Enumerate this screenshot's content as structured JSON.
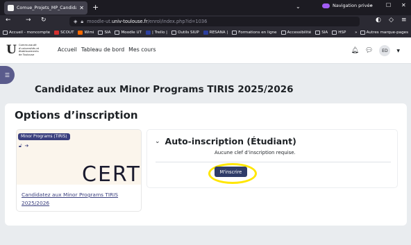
{
  "browser": {
    "tab_title": "Comue_Projets_MP_Candidature",
    "private_label": "Navigation privée",
    "url_prefix": "moodle-ut.",
    "url_domain": "univ-toulouse.fr",
    "url_path": "/enrol/index.php?id=1036"
  },
  "bookmarks": [
    {
      "label": "Accueil - moncompte",
      "icon": "globe-icon"
    },
    {
      "label": "SCOUT",
      "icon": "scout-icon"
    },
    {
      "label": "Wimi",
      "icon": "wimi-icon"
    },
    {
      "label": "SIA",
      "icon": "folder-icon"
    },
    {
      "label": "Moodle UT",
      "icon": "folder-icon"
    },
    {
      "label": "| Trello |",
      "icon": "trello-icon"
    },
    {
      "label": "Outils SIUP",
      "icon": "folder-icon"
    },
    {
      "label": "RESANA |",
      "icon": "resana-icon"
    },
    {
      "label": "Formations en ligne",
      "icon": "folder-icon"
    },
    {
      "label": "Accessibilité",
      "icon": "folder-icon"
    },
    {
      "label": "SIA",
      "icon": "folder-icon"
    },
    {
      "label": "HSP",
      "icon": "folder-icon"
    }
  ],
  "bookmarks_more": "Autres marque-pages",
  "site": {
    "logo_text": "Communauté d'universités et établissements de Toulouse",
    "nav": [
      "Accueil",
      "Tableau de bord",
      "Mes cours"
    ],
    "user_initials": "ED"
  },
  "page": {
    "title": "Candidatez aux Minor Programs TIRIS 2025/2026",
    "section_title": "Options d’inscription"
  },
  "course_card": {
    "badge": "Minor Programs (TIRIS)",
    "image_text": "CERTI",
    "link_text": "Candidatez aux Minor Programs TIRIS 2025/2026"
  },
  "enrolment": {
    "method_title": "Auto-inscription (Étudiant)",
    "no_key_text": "Aucune clef d’inscription requise.",
    "button_label": "M'inscrire"
  },
  "colors": {
    "accent": "#3a3f7e",
    "button": "#2f3c68",
    "highlight": "#ffe600"
  }
}
